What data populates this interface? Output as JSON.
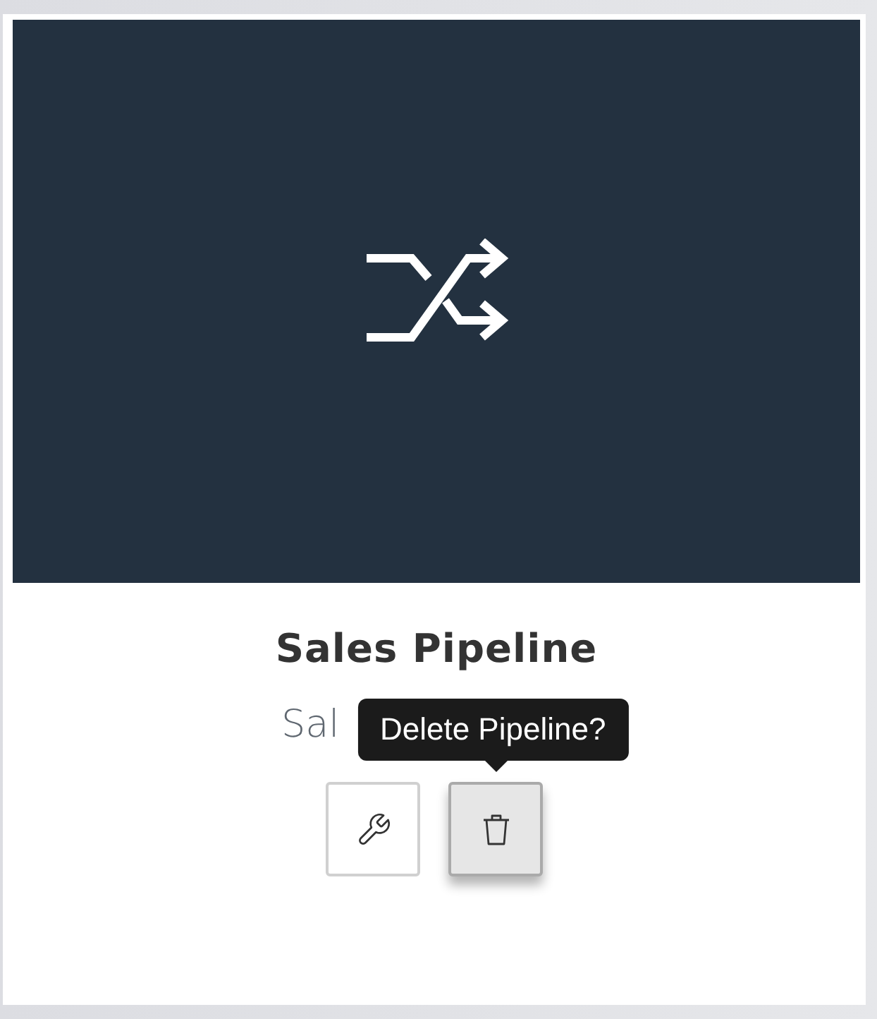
{
  "card": {
    "image": {
      "kind": "shuffle"
    },
    "title": "Sales Pipeline",
    "subtitle": "Sal",
    "actions": [
      {
        "kind": "wrench",
        "active": false
      },
      {
        "kind": "trash",
        "active": true
      }
    ],
    "tooltip": "Delete Pipeline?"
  }
}
